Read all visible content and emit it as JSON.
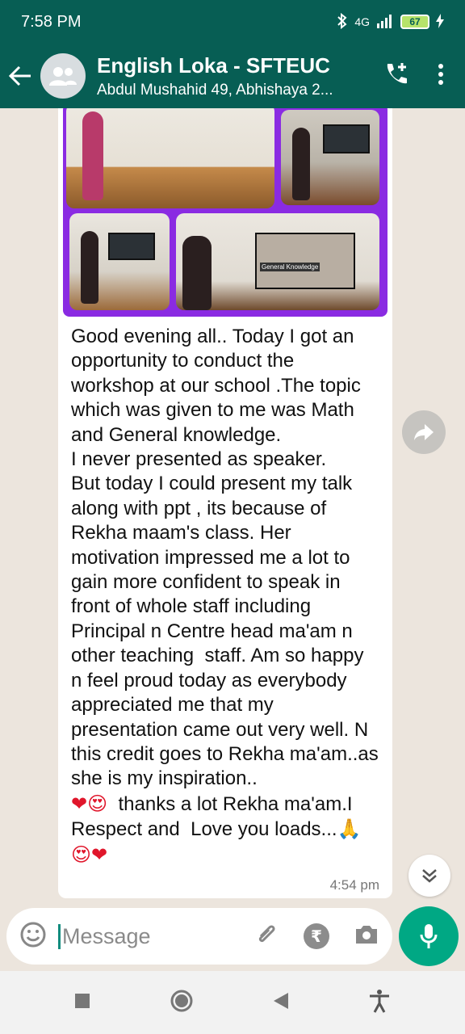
{
  "status_bar": {
    "time": "7:58 PM",
    "network": "4G",
    "battery": "67"
  },
  "header": {
    "title": "English Loka - SFTEUC",
    "subtitle": "Abdul Mushahid 49, Abhishaya 2...",
    "icons": [
      "back-arrow-icon",
      "group-avatar-icon",
      "add-call-icon",
      "more-vert-icon"
    ]
  },
  "message": {
    "image_caption_text": "General Knowledge",
    "text": "Good evening all.. Today I got an opportunity to conduct the workshop at our school .The topic which was given to me was Math and General knowledge.\nI never presented as speaker.\nBut today I could present my talk along with ppt , its because of Rekha maam's class. Her motivation impressed me a lot to gain more confident to speak in front of whole staff including Principal n Centre head ma'am n other teaching  staff. Am so happy n feel proud today as everybody appreciated me that my presentation came out very well. N this credit goes to Rekha ma'am..as she is my inspiration..",
    "closing_emoji_1": "❤😍",
    "closing_text": "  thanks a lot Rekha ma'am.I Respect and  Love you loads...",
    "closing_emoji_2": "🙏😍❤",
    "time": "4:54 pm"
  },
  "composer": {
    "placeholder": "Message",
    "value": ""
  },
  "colors": {
    "header": "#075e54",
    "accent": "#00a884",
    "collage_frame": "#8a2be2"
  }
}
